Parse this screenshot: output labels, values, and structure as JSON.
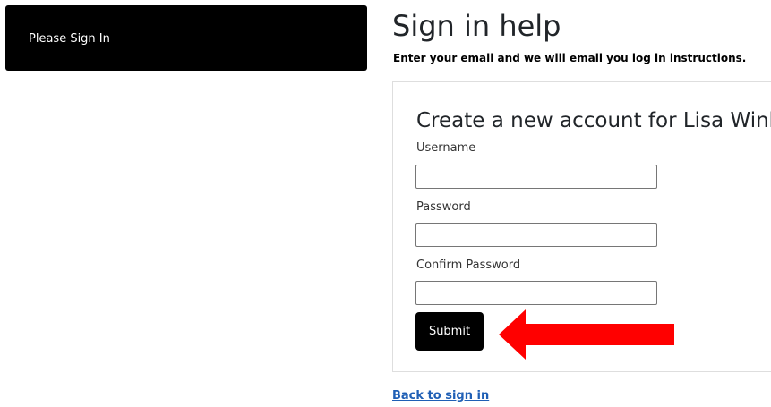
{
  "sidebar": {
    "banner_text": "Please Sign In"
  },
  "header": {
    "title": "Sign in help",
    "subtitle": "Enter your email and we will email you log in instructions."
  },
  "form": {
    "title": "Create a new account for Lisa Wink",
    "username_label": "Username",
    "username_value": "",
    "password_label": "Password",
    "password_value": "",
    "confirm_label": "Confirm Password",
    "confirm_value": "",
    "submit_label": "Submit"
  },
  "footer": {
    "back_link": "Back to sign in"
  },
  "colors": {
    "banner_bg": "#000000",
    "button_bg": "#000000",
    "link": "#1f5fb5",
    "annotation_arrow": "#ff0000"
  },
  "annotation": {
    "icon": "red-arrow-left-icon"
  }
}
